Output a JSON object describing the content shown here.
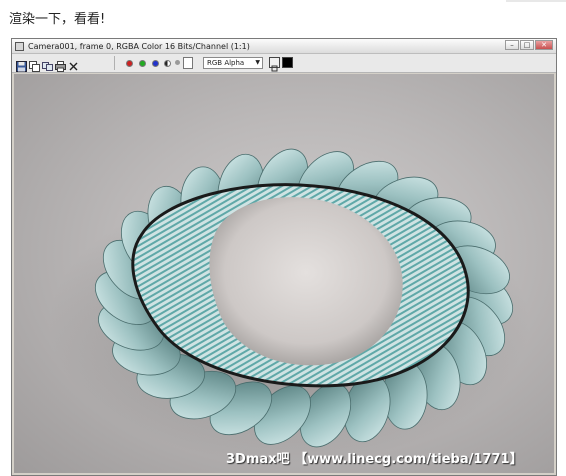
{
  "post": {
    "text": "渲染一下，看看!"
  },
  "window": {
    "title": "Camera001, frame 0, RGBA Color 16 Bits/Channel (1:1)",
    "buttons": [
      "minimize-icon",
      "maximize-icon",
      "close-icon"
    ]
  },
  "toolbar": {
    "icons": [
      "save-icon",
      "copy-icon",
      "clone-icon",
      "print-icon",
      "clear-icon"
    ],
    "channel_colors": {
      "red": "#cc2222",
      "green": "#22aa22",
      "blue": "#2233cc",
      "alpha": "#888888"
    },
    "channel_display": "RGB Alpha"
  },
  "render": {
    "watermark": "3Dmax吧 【www.linecg.com/tieba/1771】",
    "colors": {
      "background": "#b9b6b6",
      "petal": "#8fb3b3",
      "rim": "#1a1a1a",
      "stripes": "#5fa8a8",
      "dish": "#d6d2d0"
    }
  }
}
